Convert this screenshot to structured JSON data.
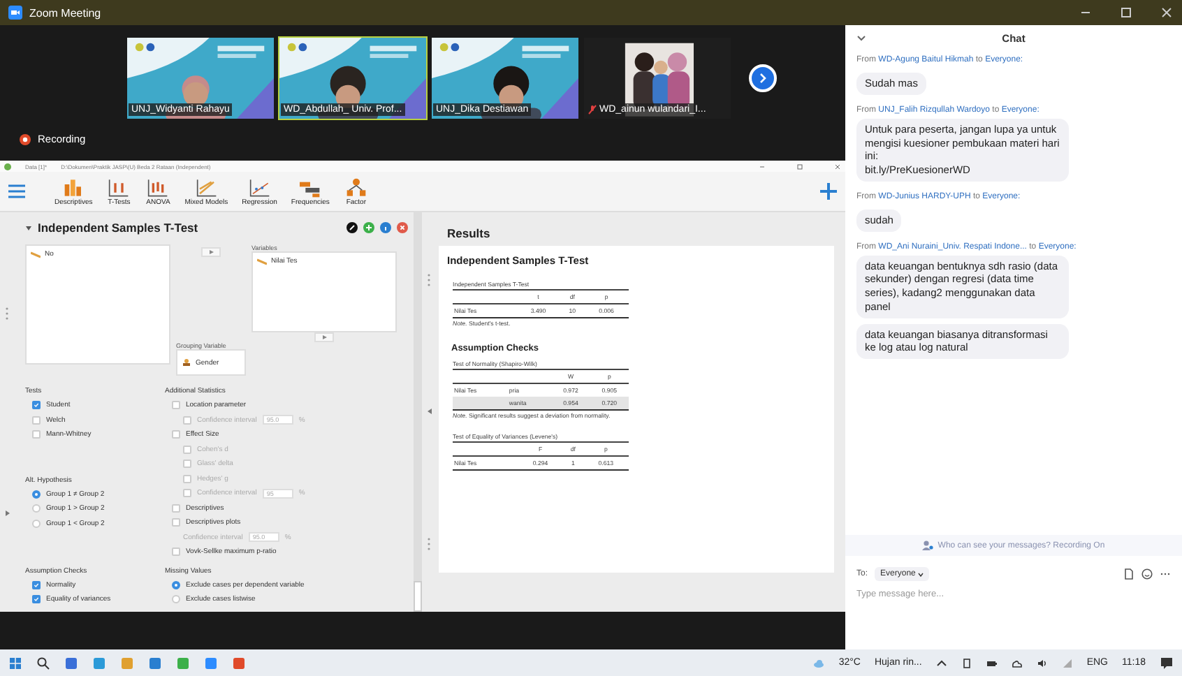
{
  "window": {
    "title": "Zoom Meeting"
  },
  "participants": [
    {
      "name": "UNJ_Widyanti Rahayu",
      "highlighted": false,
      "muted": false
    },
    {
      "name": "WD_Abdullah_ Univ. Prof...",
      "highlighted": true,
      "muted": false
    },
    {
      "name": "UNJ_Dika Destiawan",
      "highlighted": false,
      "muted": false
    },
    {
      "name": "WD_ainun wulandari_I...",
      "highlighted": false,
      "muted": true
    }
  ],
  "recording": "Recording",
  "jasp": {
    "title": "Data [1]*",
    "path": "D:\\Dokumen\\Praktik JASP\\(U) Beda 2 Rataan (Independent)",
    "toolbar": [
      {
        "label": "Descriptives"
      },
      {
        "label": "T-Tests"
      },
      {
        "label": "ANOVA"
      },
      {
        "label": "Mixed Models"
      },
      {
        "label": "Regression"
      },
      {
        "label": "Frequencies"
      },
      {
        "label": "Factor"
      }
    ],
    "analysis": {
      "title": "Independent Samples T-Test",
      "expanded": true,
      "source_variables": [
        "No"
      ],
      "variables_label": "Variables",
      "variables": [
        "Nilai Tes"
      ],
      "grouping_label": "Grouping Variable",
      "grouping": "Gender",
      "left_sections": [
        {
          "title": "Tests",
          "items": [
            {
              "kind": "checkbox",
              "label": "Student",
              "checked": true,
              "disabled": false
            },
            {
              "kind": "checkbox",
              "label": "Welch",
              "checked": false,
              "disabled": false
            },
            {
              "kind": "checkbox",
              "label": "Mann-Whitney",
              "checked": false,
              "disabled": false
            }
          ]
        },
        {
          "title": "Alt. Hypothesis",
          "items": [
            {
              "kind": "radio",
              "label": "Group 1 ≠ Group 2",
              "selected": true,
              "disabled": false
            },
            {
              "kind": "radio",
              "label": "Group 1 > Group 2",
              "selected": false,
              "disabled": false
            },
            {
              "kind": "radio",
              "label": "Group 1 < Group 2",
              "selected": false,
              "disabled": false
            }
          ]
        },
        {
          "title": "Assumption Checks",
          "items": [
            {
              "kind": "checkbox",
              "label": "Normality",
              "checked": true,
              "disabled": false
            },
            {
              "kind": "checkbox",
              "label": "Equality of variances",
              "checked": true,
              "disabled": false
            }
          ]
        }
      ],
      "right_sections": [
        {
          "title": "Additional Statistics",
          "items": [
            {
              "kind": "checkbox",
              "label": "Location parameter",
              "checked": false,
              "disabled": false,
              "children": [
                {
                  "kind": "checkbox",
                  "label": "Confidence interval",
                  "checked": false,
                  "disabled": true,
                  "value": "95.0",
                  "unit": "%"
                }
              ]
            },
            {
              "kind": "checkbox",
              "label": "Effect Size",
              "checked": false,
              "disabled": false,
              "children": [
                {
                  "kind": "checkbox",
                  "label": "Cohen's d",
                  "checked": false,
                  "disabled": true
                },
                {
                  "kind": "checkbox",
                  "label": "Glass' delta",
                  "checked": false,
                  "disabled": true
                },
                {
                  "kind": "checkbox",
                  "label": "Hedges' g",
                  "checked": false,
                  "disabled": true
                },
                {
                  "kind": "checkbox",
                  "label": "Confidence interval",
                  "checked": false,
                  "disabled": true,
                  "value": "95",
                  "unit": "%"
                }
              ]
            },
            {
              "kind": "checkbox",
              "label": "Descriptives",
              "checked": false,
              "disabled": false
            },
            {
              "kind": "checkbox",
              "label": "Descriptives plots",
              "checked": false,
              "disabled": false,
              "children": [
                {
                  "kind": "field",
                  "label": "Confidence interval",
                  "disabled": true,
                  "value": "95.0",
                  "unit": "%"
                }
              ]
            },
            {
              "kind": "checkbox",
              "label": "Vovk-Sellke maximum p-ratio",
              "checked": false,
              "disabled": false
            }
          ]
        },
        {
          "title": "Missing Values",
          "items": [
            {
              "kind": "radio",
              "label": "Exclude cases per dependent variable",
              "selected": true,
              "disabled": false
            },
            {
              "kind": "radio",
              "label": "Exclude cases listwise",
              "selected": false,
              "disabled": false
            }
          ]
        }
      ]
    },
    "results": {
      "heading": "Results",
      "title": "Independent Samples T-Test",
      "tables": [
        {
          "title": "Independent Samples T-Test",
          "columns": [
            "t",
            "df",
            "p"
          ],
          "rows": [
            {
              "variable": "Nilai Tes",
              "values": [
                "3.490",
                "10",
                "0.006"
              ],
              "selected": false
            }
          ],
          "note": "*Note.* Student's t-test."
        },
        {
          "section": "Assumption Checks",
          "title": "Test of Normality (Shapiro-Wilk)",
          "columns": [
            "W",
            "p"
          ],
          "rows": [
            {
              "variable": "Nilai Tes",
              "group": "pria",
              "values": [
                "0.972",
                "0.905"
              ],
              "selected": false
            },
            {
              "group": "wanita",
              "values": [
                "0.954",
                "0.720"
              ],
              "selected": true
            }
          ],
          "note": "*Note.* Significant results suggest a deviation from normality."
        },
        {
          "title": "Test of Equality of Variances (Levene's)",
          "columns": [
            "F",
            "df",
            "p"
          ],
          "rows": [
            {
              "variable": "Nilai Tes",
              "values": [
                "0.294",
                "1",
                "0.613"
              ],
              "selected": false
            }
          ]
        }
      ]
    }
  },
  "chat": {
    "title": "Chat",
    "messages": [
      {
        "from": "From",
        "sender": "WD-Agung Baitul Hikmah",
        "to": "to",
        "recipient": "Everyone:",
        "texts": [
          "Sudah mas"
        ]
      },
      {
        "from": "From",
        "sender": "UNJ_Falih Rizqullah Wardoyo",
        "to": "to",
        "recipient": "Everyone:",
        "texts": [
          "Untuk para peserta, jangan lupa ya untuk mengisi kuesioner pembukaan materi hari ini:\nbit.ly/PreKuesionerWD"
        ]
      },
      {
        "from": "From",
        "sender": "WD-Junius HARDY-UPH",
        "to": "to",
        "recipient": "Everyone:",
        "texts": [
          "sudah"
        ]
      },
      {
        "from": "From",
        "sender": "WD_Ani Nuraini_Univ. Respati Indone...",
        "to": "to",
        "recipient": "Everyone:",
        "texts": [
          "data keuangan bentuknya sdh rasio (data sekunder) dengan regresi (data time series), kadang2 menggunakan data panel",
          "data keuangan biasanya ditransformasi ke log atau log natural"
        ]
      }
    ],
    "notice": "Who can see your messages? Recording On",
    "to_label": "To:",
    "recipient": "Everyone",
    "placeholder": "Type message here..."
  },
  "taskbar": {
    "weather": "32°C",
    "forecast": "Hujan rin...",
    "language": "ENG",
    "time": "11:18"
  }
}
